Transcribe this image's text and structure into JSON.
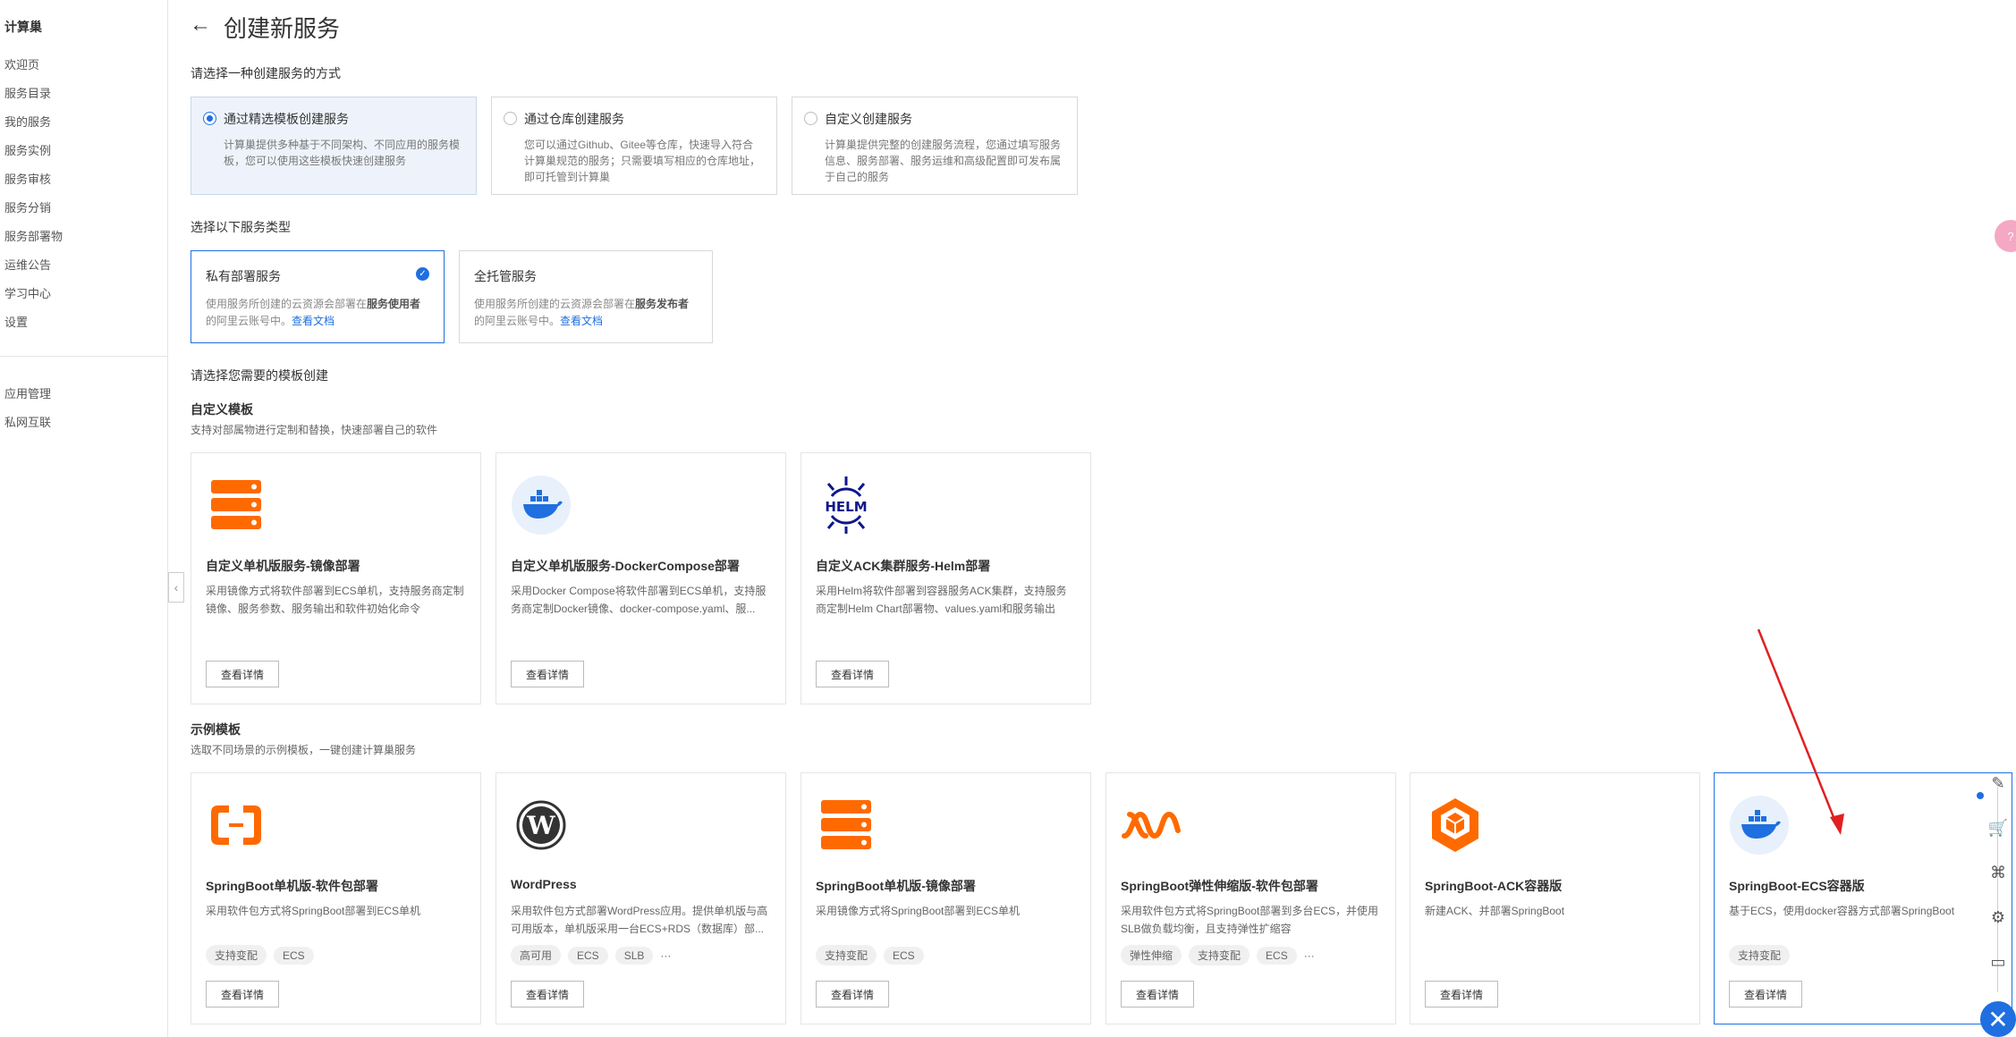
{
  "sidebar": {
    "title": "计算巢",
    "items": [
      "欢迎页",
      "服务目录",
      "我的服务",
      "服务实例",
      "服务审核",
      "服务分销",
      "服务部署物",
      "运维公告",
      "学习中心",
      "设置"
    ],
    "items2": [
      "应用管理",
      "私网互联"
    ]
  },
  "header": {
    "title": "创建新服务"
  },
  "method_section": {
    "label": "请选择一种创建服务的方式",
    "cards": [
      {
        "title": "通过精选模板创建服务",
        "desc": "计算巢提供多种基于不同架构、不同应用的服务模板，您可以使用这些模板快速创建服务",
        "selected": true
      },
      {
        "title": "通过仓库创建服务",
        "desc": "您可以通过Github、Gitee等仓库，快速导入符合计算巢规范的服务；只需要填写相应的仓库地址，即可托管到计算巢",
        "selected": false
      },
      {
        "title": "自定义创建服务",
        "desc": "计算巢提供完整的创建服务流程，您通过填写服务信息、服务部署、服务运维和高级配置即可发布属于自己的服务",
        "selected": false
      }
    ]
  },
  "type_section": {
    "label": "选择以下服务类型",
    "cards": [
      {
        "title": "私有部署服务",
        "desc_pre": "使用服务所创建的云资源会部署在",
        "desc_bold": "服务使用者",
        "desc_post": "的阿里云账号中。",
        "link": "查看文档",
        "selected": true
      },
      {
        "title": "全托管服务",
        "desc_pre": "使用服务所创建的云资源会部署在",
        "desc_bold": "服务发布者",
        "desc_post": "的阿里云账号中。",
        "link": "查看文档",
        "selected": false
      }
    ]
  },
  "template_section": {
    "label": "请选择您需要的模板创建",
    "custom_title": "自定义模板",
    "custom_sub": "支持对部属物进行定制和替换，快速部署自己的软件",
    "custom_cards": [
      {
        "icon": "server-stack-icon",
        "title": "自定义单机版服务-镜像部署",
        "desc": "采用镜像方式将软件部署到ECS单机，支持服务商定制镜像、服务参数、服务输出和软件初始化命令",
        "button": "查看详情"
      },
      {
        "icon": "docker-icon",
        "title": "自定义单机版服务-DockerCompose部署",
        "desc": "采用Docker Compose将软件部署到ECS单机，支持服务商定制Docker镜像、docker-compose.yaml、服...",
        "button": "查看详情"
      },
      {
        "icon": "helm-icon",
        "title": "自定义ACK集群服务-Helm部署",
        "desc": "采用Helm将软件部署到容器服务ACK集群，支持服务商定制Helm Chart部署物、values.yaml和服务输出",
        "button": "查看详情"
      }
    ],
    "example_title": "示例模板",
    "example_sub": "选取不同场景的示例模板，一键创建计算巢服务",
    "example_cards": [
      {
        "icon": "aliyun-icon",
        "title": "SpringBoot单机版-软件包部署",
        "desc": "采用软件包方式将SpringBoot部署到ECS单机",
        "tags": [
          "支持变配",
          "ECS"
        ],
        "more": false,
        "button": "查看详情"
      },
      {
        "icon": "wordpress-icon",
        "title": "WordPress",
        "desc": "采用软件包方式部署WordPress应用。提供单机版与高可用版本，单机版采用一台ECS+RDS（数据库）部...",
        "tags": [
          "高可用",
          "ECS",
          "SLB"
        ],
        "more": true,
        "button": "查看详情"
      },
      {
        "icon": "server-stack-icon",
        "title": "SpringBoot单机版-镜像部署",
        "desc": "采用镜像方式将SpringBoot部署到ECS单机",
        "tags": [
          "支持变配",
          "ECS"
        ],
        "more": false,
        "button": "查看详情"
      },
      {
        "icon": "elastic-wave-icon",
        "title": "SpringBoot弹性伸缩版-软件包部署",
        "desc": "采用软件包方式将SpringBoot部署到多台ECS，并使用SLB做负载均衡，且支持弹性扩缩容",
        "tags": [
          "弹性伸缩",
          "支持变配",
          "ECS"
        ],
        "more": true,
        "button": "查看详情"
      },
      {
        "icon": "ack-cube-icon",
        "title": "SpringBoot-ACK容器版",
        "desc": "新建ACK、并部署SpringBoot",
        "tags": [],
        "more": false,
        "button": "查看详情"
      },
      {
        "icon": "docker-icon",
        "title": "SpringBoot-ECS容器版",
        "desc": "基于ECS，使用docker容器方式部署SpringBoot",
        "tags": [
          "支持变配"
        ],
        "more": false,
        "button": "查看详情"
      }
    ]
  },
  "more_glyph": "···",
  "colors": {
    "accent": "#1f6fe0",
    "orange": "#ff6a00",
    "helm_navy": "#0f1689",
    "annotation_red": "#e02020"
  }
}
